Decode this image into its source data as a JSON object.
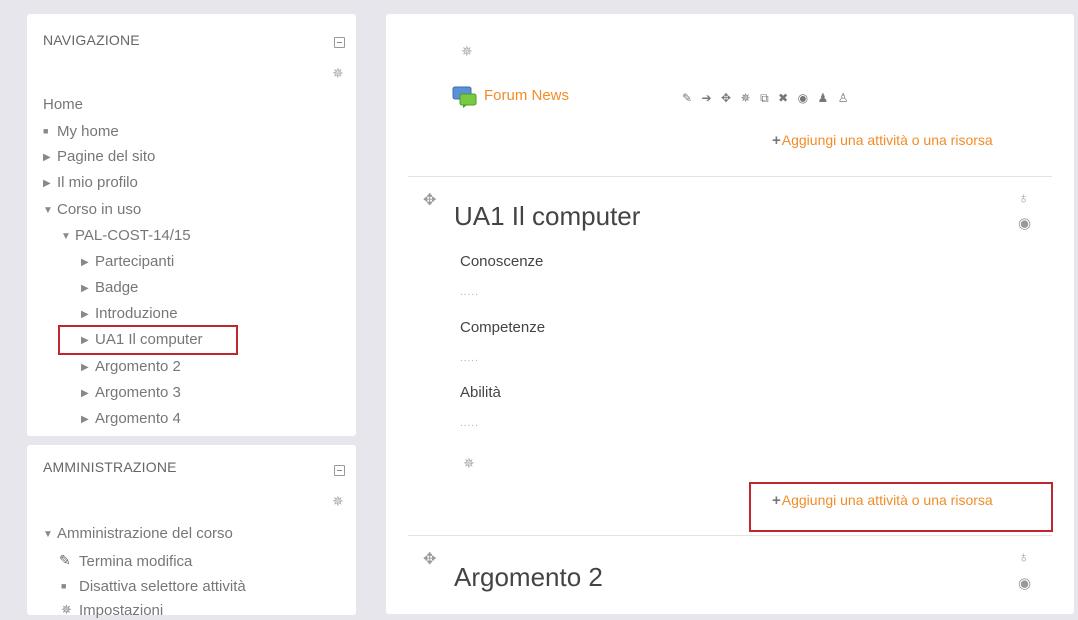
{
  "navigation": {
    "title": "NAVIGAZIONE",
    "home": "Home",
    "items": [
      {
        "label": "My home"
      },
      {
        "label": "Pagine del sito"
      },
      {
        "label": "Il mio profilo"
      },
      {
        "label": "Corso in uso"
      },
      {
        "label": "PAL-COST-14/15"
      },
      {
        "label": "Partecipanti"
      },
      {
        "label": "Badge"
      },
      {
        "label": "Introduzione"
      },
      {
        "label": "UA1 Il computer"
      },
      {
        "label": "Argomento 2"
      },
      {
        "label": "Argomento 3"
      },
      {
        "label": "Argomento 4"
      }
    ]
  },
  "administration": {
    "title": "AMMINISTRAZIONE",
    "items": [
      {
        "label": "Amministrazione del corso"
      },
      {
        "label": "Termina modifica"
      },
      {
        "label": "Disattiva selettore attività"
      },
      {
        "label": "Impostazioni"
      }
    ]
  },
  "main": {
    "forum_link": "Forum News",
    "add_activity": "Aggiungi una attività o una risorsa",
    "section1": {
      "title": "UA1 Il computer",
      "summary": [
        {
          "label": "Conoscenze",
          "dots": "....."
        },
        {
          "label": "Competenze",
          "dots": "....."
        },
        {
          "label": "Abilità",
          "dots": "....."
        }
      ]
    },
    "section2": {
      "title": "Argomento 2"
    }
  },
  "colors": {
    "highlight": "#c0262d",
    "link": "#f28c28"
  }
}
